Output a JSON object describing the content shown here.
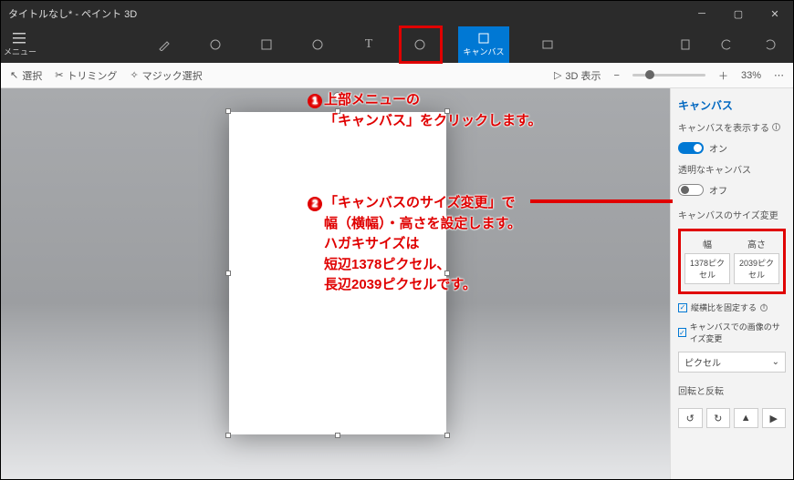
{
  "title": "タイトルなし* - ペイント 3D",
  "menu_label": "メニュー",
  "top_tools": {
    "brush": "brush",
    "shapes2d": "2d",
    "shapes3d": "3d",
    "stickers": "stickers",
    "text": "T",
    "effects": "effects",
    "canvas_label": "キャンバス",
    "library": "library"
  },
  "subbar": {
    "select": "選択",
    "trim": "トリミング",
    "magic": "マジック選択",
    "view3d": "3D 表示",
    "zoom_pct": "33%"
  },
  "side": {
    "header": "キャンバス",
    "show_canvas": "キャンバスを表示する",
    "show_canvas_state": "オン",
    "transparent": "透明なキャンバス",
    "transparent_state": "オフ",
    "resize_section": "キャンバスのサイズ変更",
    "w_label": "幅",
    "h_label": "高さ",
    "width_val": "1378ピクセル",
    "height_val": "2039ピクセル",
    "lock_aspect": "縦横比を固定する",
    "resize_image": "キャンバスでの画像のサイズ変更",
    "unit": "ピクセル",
    "rotate_section": "回転と反転"
  },
  "ann1_l1": "上部メニューの",
  "ann1_l2": "「キャンバス」をクリックします。",
  "ann2_l1": "「キャンバスのサイズ変更」で",
  "ann2_l2": "幅（横幅）・高さを設定します。",
  "ann2_l3": "ハガキサイズは",
  "ann2_l4": "短辺1378ピクセル、",
  "ann2_l5": "長辺2039ピクセルです。"
}
